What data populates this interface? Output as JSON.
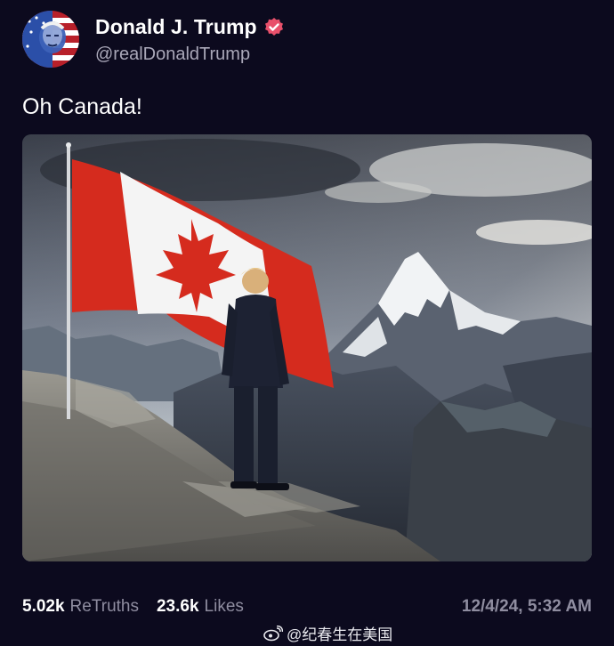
{
  "author": {
    "display_name": "Donald J. Trump",
    "handle": "@realDonaldTrump",
    "verified": true
  },
  "post": {
    "text": "Oh Canada!",
    "image_description": "man-standing-on-mountain-beside-canadian-flag"
  },
  "stats": {
    "retruths_count": "5.02k",
    "retruths_label": "ReTruths",
    "likes_count": "23.6k",
    "likes_label": "Likes",
    "timestamp": "12/4/24, 5:32 AM"
  },
  "watermark": {
    "text": "@纪春生在美国"
  },
  "colors": {
    "background": "#0c0a1e",
    "verified_badge": "#e8506b",
    "muted_text": "#8f8da0",
    "flag_red": "#d52b1e"
  }
}
